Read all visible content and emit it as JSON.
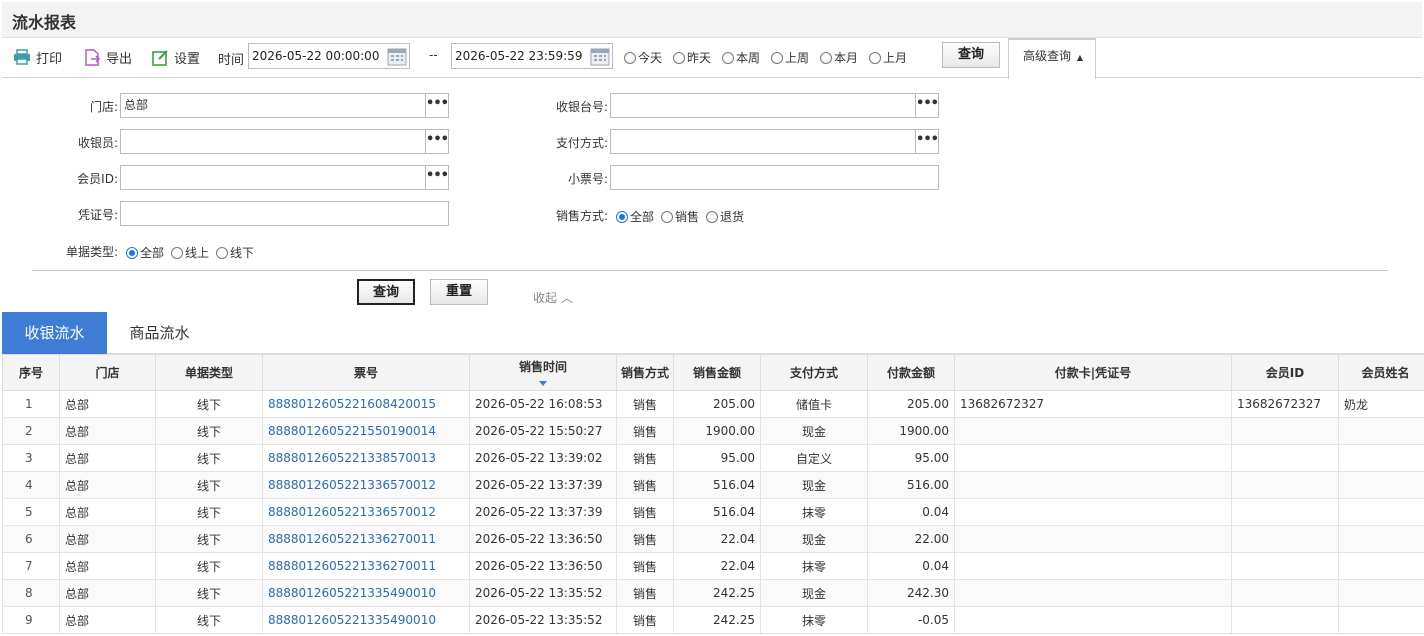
{
  "page_title": "流水报表",
  "toolbar": {
    "print_label": "打印",
    "export_label": "导出",
    "settings_label": "设置",
    "time_label": "时间",
    "start_time": "2026-05-22 00:00:00",
    "separator": "--",
    "end_time": "2026-05-22 23:59:59",
    "quick_ranges": [
      "今天",
      "昨天",
      "本周",
      "上周",
      "本月",
      "上月"
    ],
    "query_label": "查询",
    "advanced_label": "高级查询"
  },
  "filters": {
    "store_label": "门店:",
    "store_value": "总部",
    "register_label": "收银台号:",
    "cashier_label": "收银员:",
    "payment_label": "支付方式:",
    "member_label": "会员ID:",
    "receipt_label": "小票号:",
    "voucher_label": "凭证号:",
    "sale_mode_label": "销售方式:",
    "sale_mode_options": [
      "全部",
      "销售",
      "退货"
    ],
    "doc_type_label": "单据类型:",
    "doc_type_options": [
      "全部",
      "线上",
      "线下"
    ],
    "query_label": "查询",
    "reset_label": "重置",
    "collapse_label": "收起"
  },
  "tabs": [
    "收银流水",
    "商品流水"
  ],
  "table": {
    "headers": [
      "序号",
      "门店",
      "单据类型",
      "票号",
      "销售时间",
      "销售方式",
      "销售金额",
      "支付方式",
      "付款金额",
      "付款卡|凭证号",
      "会员ID",
      "会员姓名"
    ],
    "rows": [
      [
        "1",
        "总部",
        "线下",
        "888801260522160842001​5",
        "2026-05-22 16:08:53",
        "销售",
        "205.00",
        "储值卡",
        "205.00",
        "13682672327",
        "13682672327",
        "奶龙"
      ],
      [
        "2",
        "总部",
        "线下",
        "888801260522155019001​4",
        "2026-05-22 15:50:27",
        "销售",
        "1900.00",
        "现金",
        "1900.00",
        "",
        "",
        ""
      ],
      [
        "3",
        "总部",
        "线下",
        "888801260522133857001​3",
        "2026-05-22 13:39:02",
        "销售",
        "95.00",
        "自定义",
        "95.00",
        "",
        "",
        ""
      ],
      [
        "4",
        "总部",
        "线下",
        "888801260522133657001​2",
        "2026-05-22 13:37:39",
        "销售",
        "516.04",
        "现金",
        "516.00",
        "",
        "",
        ""
      ],
      [
        "5",
        "总部",
        "线下",
        "888801260522133657001​2",
        "2026-05-22 13:37:39",
        "销售",
        "516.04",
        "抹零",
        "0.04",
        "",
        "",
        ""
      ],
      [
        "6",
        "总部",
        "线下",
        "888801260522133627001​1",
        "2026-05-22 13:36:50",
        "销售",
        "22.04",
        "现金",
        "22.00",
        "",
        "",
        ""
      ],
      [
        "7",
        "总部",
        "线下",
        "888801260522133627001​1",
        "2026-05-22 13:36:50",
        "销售",
        "22.04",
        "抹零",
        "0.04",
        "",
        "",
        ""
      ],
      [
        "8",
        "总部",
        "线下",
        "888801260522133549001​0",
        "2026-05-22 13:35:52",
        "销售",
        "242.25",
        "现金",
        "242.30",
        "",
        "",
        ""
      ],
      [
        "9",
        "总部",
        "线下",
        "888801260522133549001​0",
        "2026-05-22 13:35:52",
        "销售",
        "242.25",
        "抹零",
        "-0.05",
        "",
        "",
        ""
      ]
    ]
  },
  "colors": {
    "accent": "#3d7dd6",
    "link": "#2a6cb0"
  }
}
